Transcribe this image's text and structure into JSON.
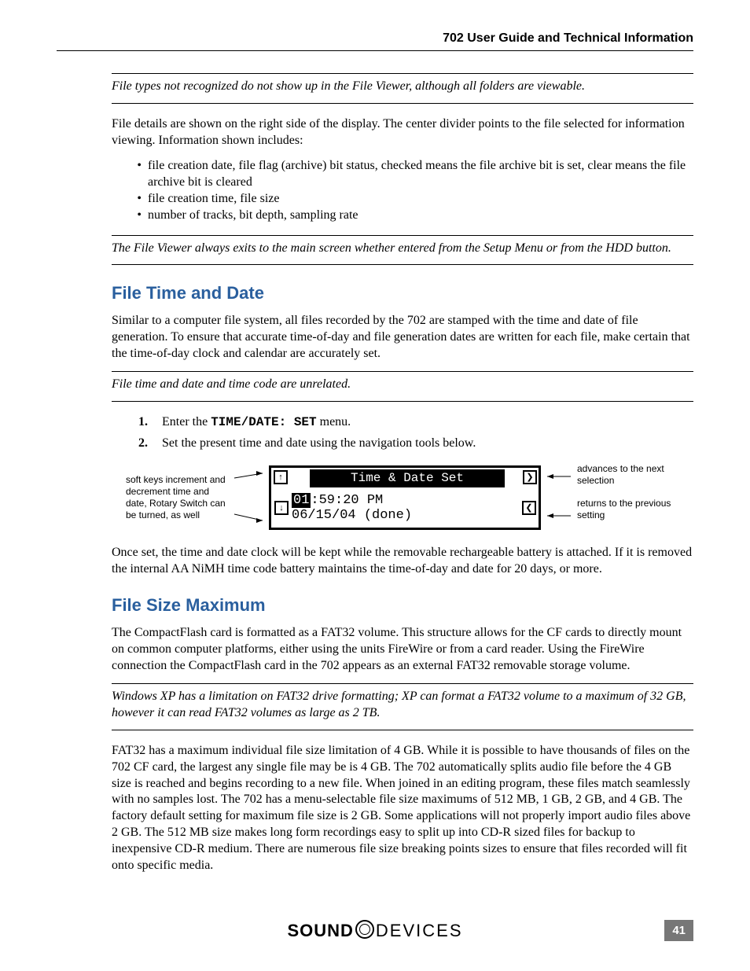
{
  "header": {
    "title": "702 User Guide and Technical Information"
  },
  "notes": {
    "note1": "File types not recognized do not show up in the File Viewer, although all folders are viewable.",
    "note2": "The File Viewer always exits to the main screen whether entered from the Setup Menu or from the HDD button.",
    "note3": "File time and date and time code are unrelated.",
    "note4": "Windows XP has a limitation on FAT32 drive formatting; XP can format a FAT32 volume to a maximum of 32 GB, however it can read FAT32 volumes as large as 2 TB."
  },
  "para": {
    "p1": "File details are shown on the right side of the display. The center divider points to the file selected for information viewing. Information shown includes:",
    "p2": "Similar to a computer file system, all files recorded by the 702 are stamped with the time and date of file generation. To ensure that accurate time-of-day and file generation dates are written for each file, make certain that the time-of-day clock and calendar are accurately set.",
    "p3": "Once set, the time and date clock will be kept while the removable rechargeable battery is attached. If it is removed the internal AA NiMH time code battery maintains the time-of-day and date for 20 days, or more.",
    "p4": "The CompactFlash card is formatted as a FAT32 volume. This structure allows for the CF cards to directly mount on common computer platforms, either using the units FireWire or from a card reader. Using the FireWire connection the CompactFlash card in the 702 appears as an external FAT32 removable storage volume.",
    "p5": "FAT32 has a maximum individual file size limitation of 4 GB. While it is possible to have thousands of files on the 702 CF card, the largest any single file may be is 4 GB. The 702 automatically splits audio file before the 4 GB size is reached and begins recording to a new file. When joined in an editing program, these files match seamlessly with no samples lost. The 702 has a menu-selectable file size maximums of 512 MB, 1 GB, 2 GB, and 4 GB. The factory default setting for maximum file size is 2 GB. Some applications will not properly import audio files above 2 GB. The 512 MB size makes long form recordings easy to split up into CD-R sized files for backup to inexpensive CD-R medium. There are numerous file size breaking points  sizes to ensure that files recorded will fit onto specific media."
  },
  "bullets": {
    "b1": "file creation date, file flag (archive) bit status, checked means the file archive bit is set, clear means the file archive bit is cleared",
    "b2": "file creation time, file size",
    "b3": "number of tracks, bit depth, sampling rate"
  },
  "headings": {
    "h1": "File Time and Date",
    "h2": "File Size Maximum"
  },
  "steps": {
    "s1_pre": "Enter the ",
    "s1_menu": "TIME/DATE: SET",
    "s1_post": " menu.",
    "s2": "Set the present time and date using the navigation tools below."
  },
  "figure": {
    "left_text": "soft keys increment and decrement time and date, Rotary Switch can be turned, as well",
    "right_top": "advances to the next selection",
    "right_bottom": "returns to the previous setting",
    "lcd_title": "Time & Date Set",
    "lcd_line1_hl": "01",
    "lcd_line1_rest": ":59:20 PM",
    "lcd_line2": "06/15/04 (done)",
    "up": "↑",
    "down": "↓",
    "fwd": "❯",
    "back": "❮"
  },
  "footer": {
    "logo_bold": "SOUND",
    "logo_thin": "DEVICES",
    "page": "41"
  }
}
